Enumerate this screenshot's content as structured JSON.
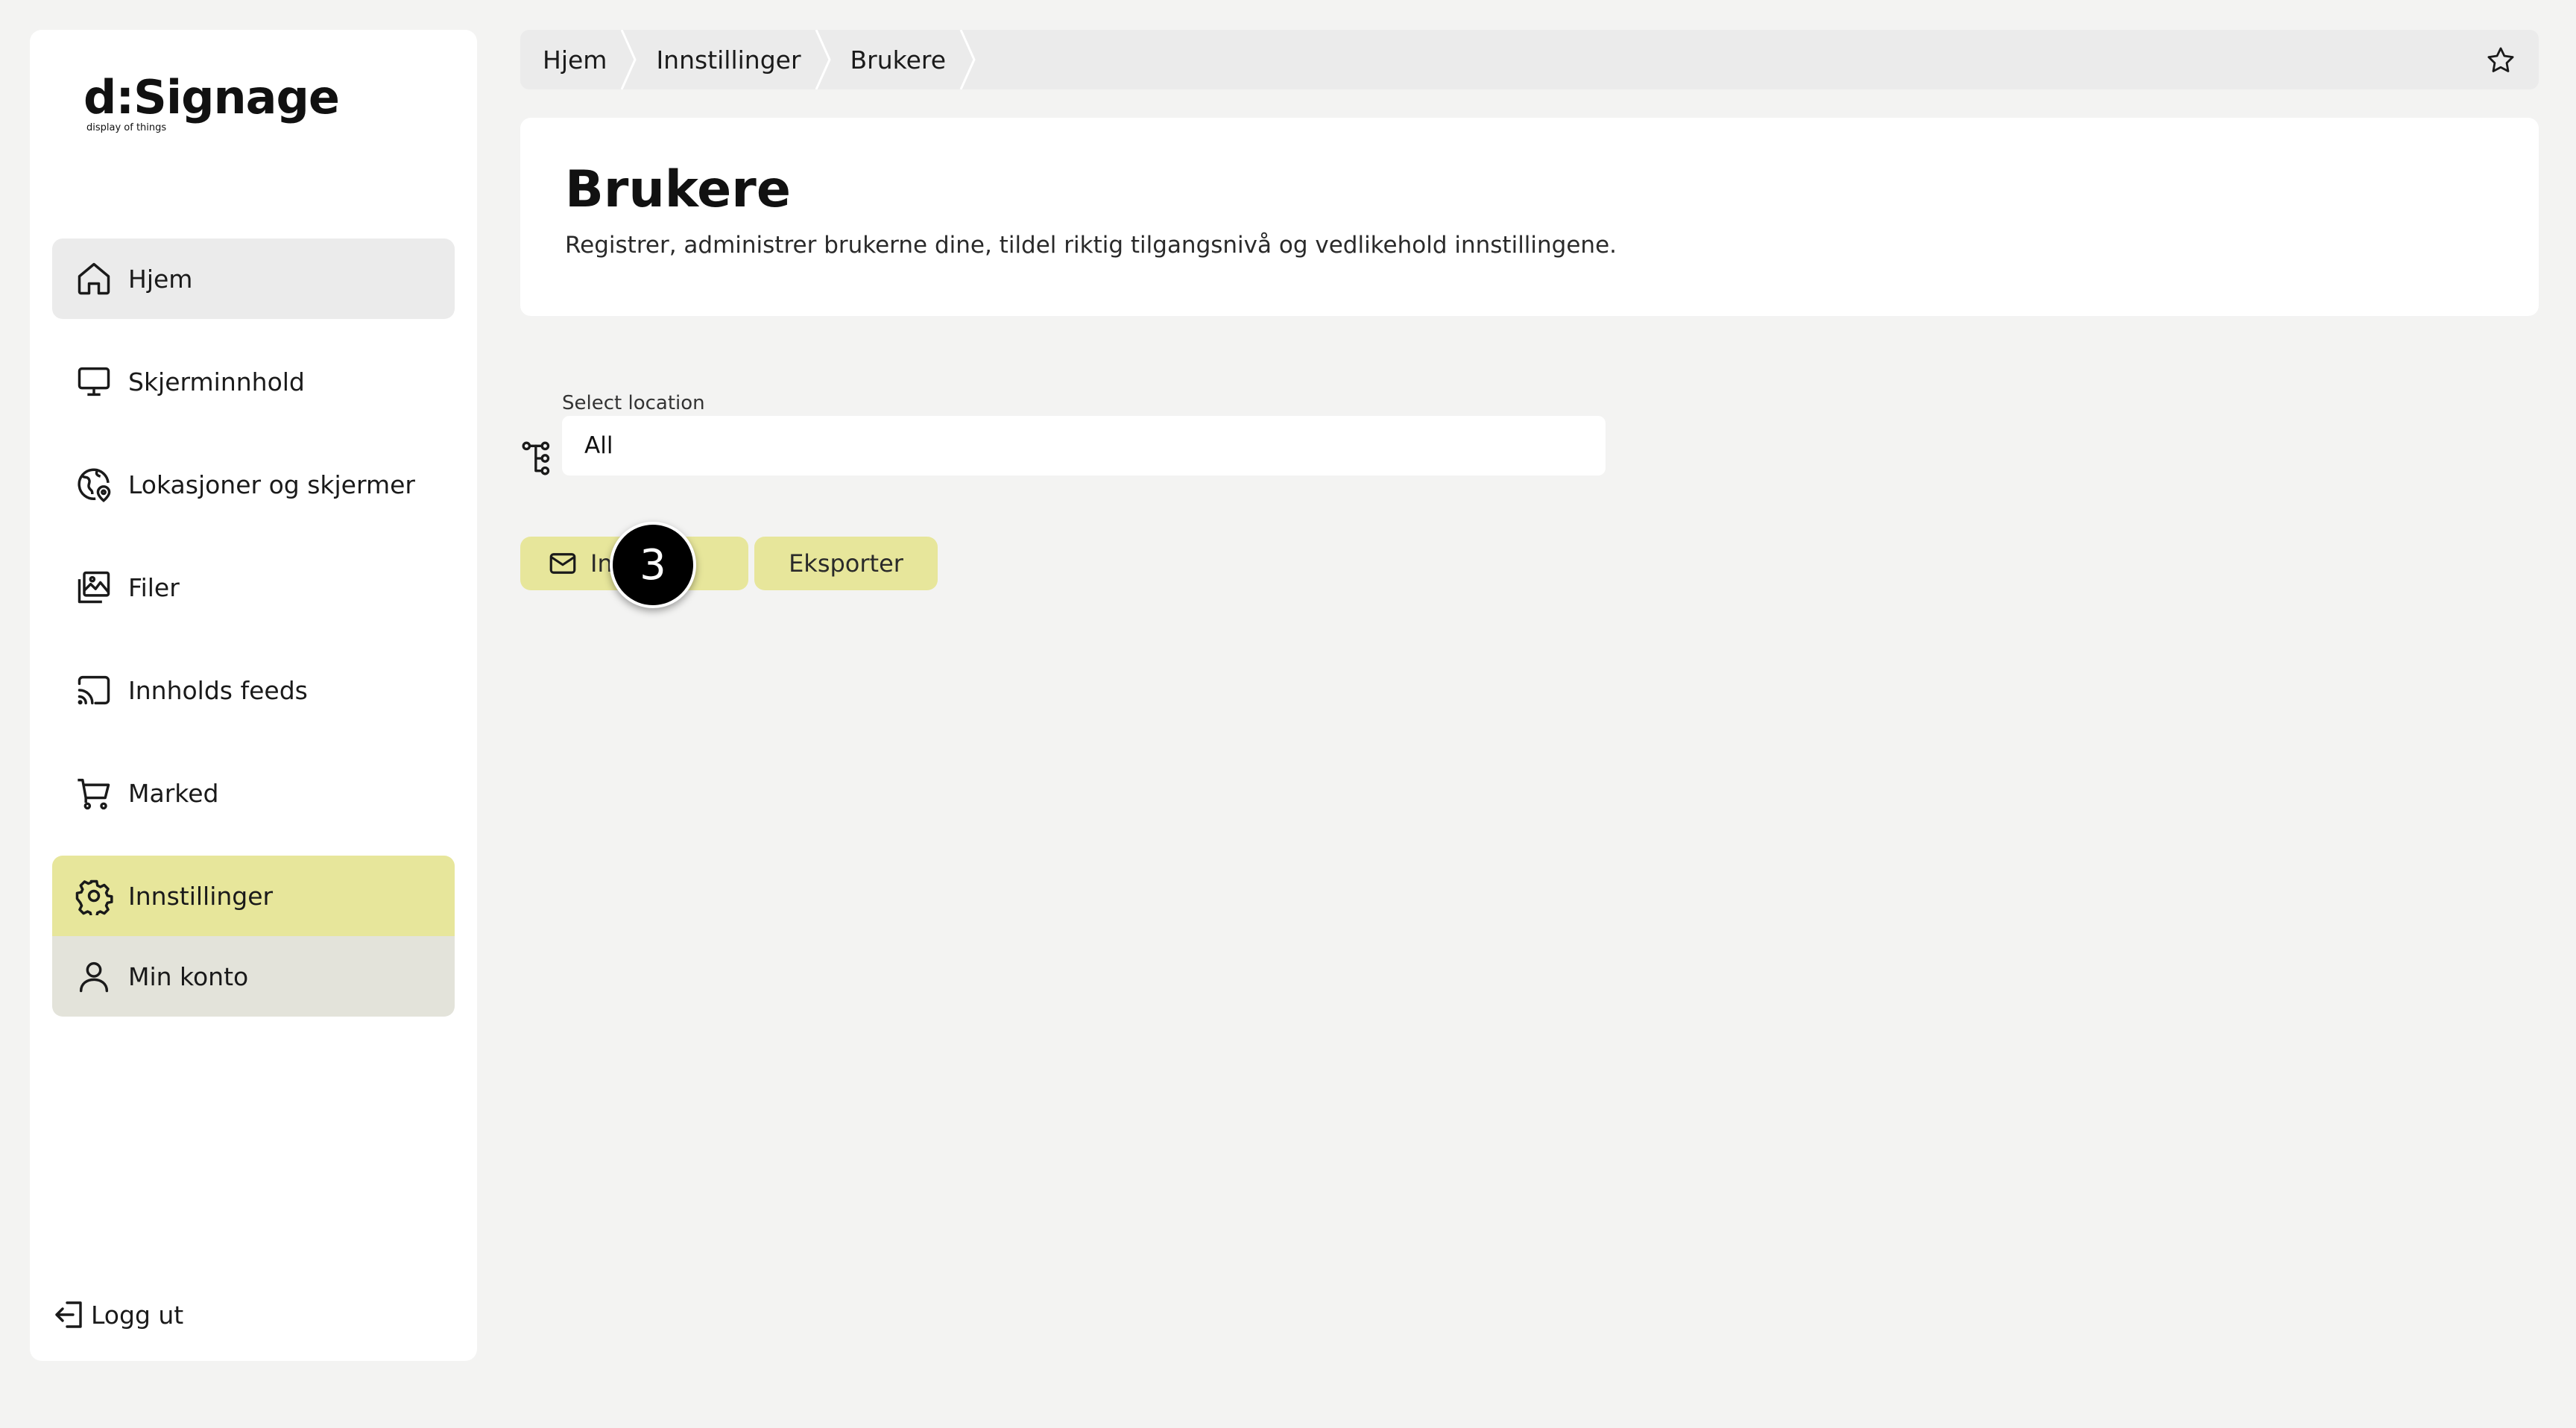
{
  "brand": {
    "name": "d:Signage",
    "tagline": "display of things",
    "accent": "#e7e69b"
  },
  "sidebar": {
    "items": [
      {
        "label": "Hjem",
        "icon": "home-icon"
      },
      {
        "label": "Skjerminnhold",
        "icon": "monitor-icon"
      },
      {
        "label": "Lokasjoner og skjermer",
        "icon": "location-globe-icon"
      },
      {
        "label": "Filer",
        "icon": "images-icon"
      },
      {
        "label": "Innholds feeds",
        "icon": "cast-icon"
      },
      {
        "label": "Marked",
        "icon": "cart-icon"
      },
      {
        "label": "Innstillinger",
        "icon": "gear-icon"
      },
      {
        "label": "Min konto",
        "icon": "user-icon"
      }
    ],
    "logout_label": "Logg ut"
  },
  "breadcrumb": {
    "items": [
      "Hjem",
      "Innstillinger",
      "Brukere"
    ]
  },
  "header": {
    "title": "Brukere",
    "description": "Registrer, administrer brukerne dine, tildel riktig tilgangsnivå og vedlikehold innstillingene."
  },
  "location": {
    "label": "Select location",
    "value": "All"
  },
  "actions": {
    "invite_label": "Inviter",
    "export_label": "Eksporter"
  },
  "marker": {
    "number": "3"
  }
}
